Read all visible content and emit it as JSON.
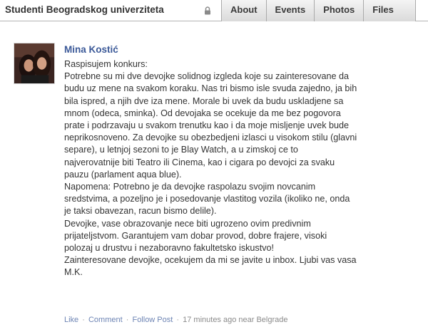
{
  "group": {
    "title": "Studenti Beogradskog univerziteta",
    "lock_icon": "lock-icon"
  },
  "tabs": [
    {
      "label": "About"
    },
    {
      "label": "Events"
    },
    {
      "label": "Photos"
    },
    {
      "label": "Files"
    }
  ],
  "post": {
    "author": "Mina Kostić",
    "lines": [
      "Raspisujem konkurs:",
      "Potrebne su mi dve devojke solidnog izgleda koje su zainteresovane da",
      "budu uz mene na svakom koraku. Nas tri bismo isle svuda zajedno, ja bih",
      "bila ispred, a njih dve iza mene. Morale bi uvek da budu uskladjene sa",
      "mnom (odeca, sminka). Od devojaka se ocekuje da me bez pogovora",
      "prate i podrzavaju u svakom trenutku kao i da moje misljenje uvek bude",
      "neprikosnoveno. Za devojke su obezbedjeni izlasci u visokom stilu (glavni",
      "separe), u letnjoj sezoni to je Blay Watch, a u zimskoj ce to",
      "najverovatnije biti Teatro ili Cinema, kao i cigara po devojci za svaku",
      "pauzu (parlament aqua blue).",
      "Napomena: Potrebno je da devojke raspolazu svojim novcanim",
      "sredstvima, a pozeljno je i posedovanje vlastitog vozila (ikoliko ne, onda",
      "je taksi obavezan, racun bismo delile).",
      "Devojke, vase obrazovanje nece biti ugrozeno ovim predivnim",
      "prijateljstvom. Garantujem vam dobar provod, dobre frajere, visoki",
      "polozaj u drustvu i nezaboravno fakultetsko iskustvo!",
      "Zainteresovane devojke, ocekujem da mi se javite u inbox. Ljubi vas vasa",
      "M.K."
    ],
    "footer": {
      "like": "Like",
      "comment": "Comment",
      "follow": "Follow Post",
      "time": "17 minutes ago near Belgrade",
      "separator": "·"
    }
  },
  "colors": {
    "link": "#3b5998",
    "footer_link": "#6d84b4",
    "text": "#333333"
  }
}
